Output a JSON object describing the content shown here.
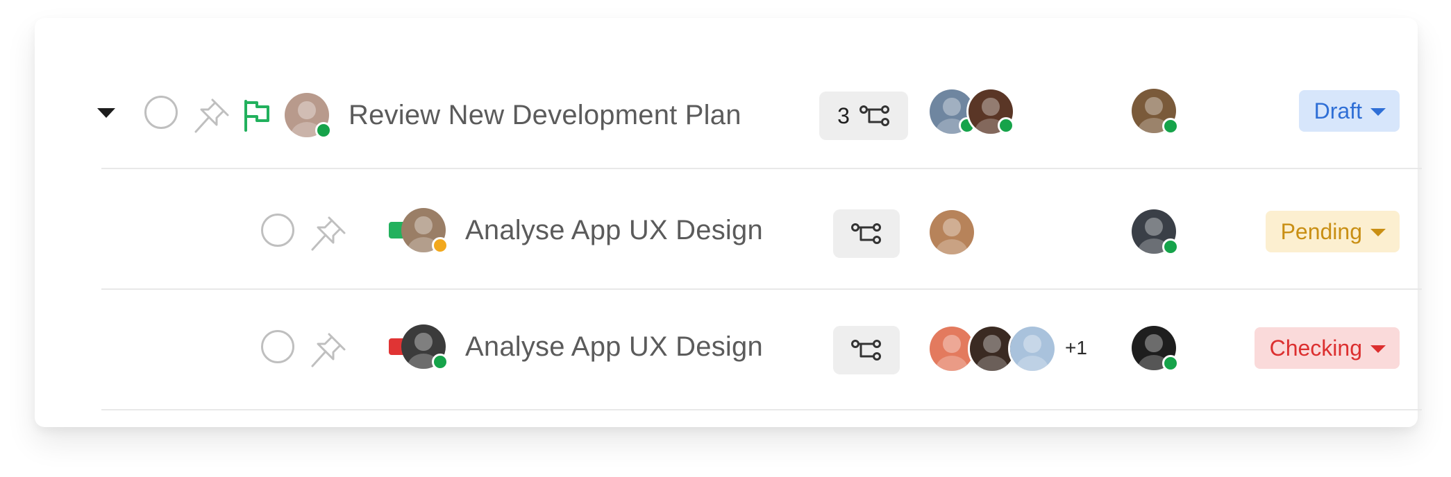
{
  "tasks": [
    {
      "title": "Review New Development Plan",
      "subtask_count": "3",
      "priority_icon": "flag-icon",
      "priority_color": "#22b15d",
      "owner": {
        "bg": "#b89a8c",
        "status": "#16a34a"
      },
      "assignees": [
        {
          "bg": "#6f86a0",
          "status": "#16a34a"
        },
        {
          "bg": "#5a3626",
          "status": "#16a34a"
        }
      ],
      "more_assignees": "",
      "reviewer": {
        "bg": "#7a5a3a",
        "status": "#16a34a"
      },
      "status": {
        "label": "Draft",
        "bg": "#d7e6fb",
        "color": "#2f6fd6"
      }
    },
    {
      "title": "Analyse App UX Design",
      "subtask_count": "",
      "priority_color": "#22b15d",
      "owner": {
        "bg": "#9a7e66",
        "status": "#f2a81d"
      },
      "assignees": [
        {
          "bg": "#b7835a",
          "status": ""
        }
      ],
      "more_assignees": "",
      "reviewer": {
        "bg": "#3a3f47",
        "status": "#16a34a"
      },
      "status": {
        "label": "Pending",
        "bg": "#fcefd0",
        "color": "#c98f14"
      }
    },
    {
      "title": "Analyse App UX Design",
      "subtask_count": "",
      "priority_color": "#e03434",
      "owner": {
        "bg": "#3b3b3b",
        "status": "#16a34a"
      },
      "assignees": [
        {
          "bg": "#e37a5e",
          "status": ""
        },
        {
          "bg": "#3a2a22",
          "status": ""
        },
        {
          "bg": "#a9c2dc",
          "status": ""
        }
      ],
      "more_assignees": "+1",
      "reviewer": {
        "bg": "#1e1e1e",
        "status": "#16a34a"
      },
      "status": {
        "label": "Checking",
        "bg": "#fadada",
        "color": "#dc2f2f"
      }
    }
  ],
  "colors": {
    "divider": "#e8e8e8",
    "title_text": "#5b5b5b",
    "icon_gray": "#bfbfbf",
    "subtask_chip_bg": "#eeeeee"
  }
}
